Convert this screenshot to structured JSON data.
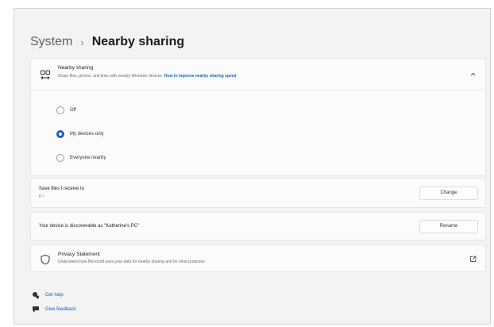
{
  "breadcrumb": {
    "parent": "System",
    "separator": "›",
    "current": "Nearby sharing"
  },
  "nearby_sharing": {
    "title": "Nearby sharing",
    "description": "Share files, photos, and links with nearby Windows devices",
    "link": "How to improve nearby sharing speed",
    "expanded": true,
    "options": [
      {
        "label": "Off",
        "selected": false
      },
      {
        "label": "My devices only",
        "selected": true
      },
      {
        "label": "Everyone nearby",
        "selected": false
      }
    ]
  },
  "save_files": {
    "label": "Save files I receive to",
    "path": "P:\\",
    "button": "Change"
  },
  "discoverable": {
    "label": "Your device is discoverable as \"Katherine's PC\"",
    "button": "Rename"
  },
  "privacy": {
    "title": "Privacy Statement",
    "description": "Understand how Microsoft uses your data for nearby sharing and for what purposes"
  },
  "help": {
    "get_help": "Get help",
    "give_feedback": "Give feedback"
  },
  "colors": {
    "accent": "#1f5fbe",
    "link": "#1b5fb4",
    "background": "#f3f3f3",
    "card": "#fbfbfb"
  }
}
